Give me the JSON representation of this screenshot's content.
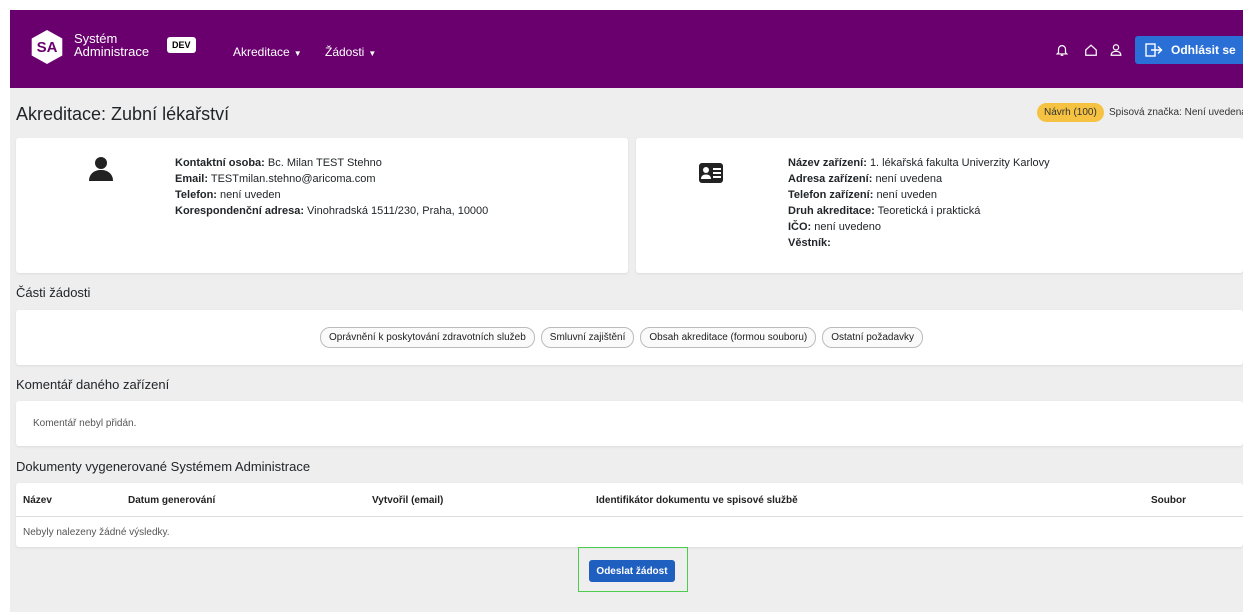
{
  "navbar": {
    "logo_initials": "SA",
    "app_name_line1": "Systém",
    "app_name_line2": "Administrace",
    "env_badge": "DEV",
    "menu": [
      {
        "label": "Akreditace"
      },
      {
        "label": "Žádosti"
      }
    ],
    "logout_label": "Odhlásit se",
    "icons": [
      "bell-icon",
      "home-icon",
      "user-icon",
      "logout-icon"
    ],
    "bg_color": "#6a006e",
    "logout_color": "#2a6fd6"
  },
  "page": {
    "title": "Akreditace: Zubní lékařství",
    "status_badge": "Návrh (100)",
    "file_ref": "Spisová značka: Není uvedena"
  },
  "contact_card": {
    "icon": "person-icon",
    "rows": [
      {
        "label": "Kontaktní osoba:",
        "value": "Bc. Milan TEST Stehno"
      },
      {
        "label": "Email:",
        "value": "TESTmilan.stehno@aricoma.com"
      },
      {
        "label": "Telefon:",
        "value": "není uveden"
      },
      {
        "label": "Korespondenční adresa:",
        "value": "Vinohradská 1511/230, Praha, 10000"
      }
    ]
  },
  "facility_card": {
    "icon": "id-card-icon",
    "rows": [
      {
        "label": "Název zařízení:",
        "value": "1. lékařská fakulta Univerzity Karlovy"
      },
      {
        "label": "Adresa zařízení:",
        "value": "není uvedena"
      },
      {
        "label": "Telefon zařízení:",
        "value": "není uveden"
      },
      {
        "label": "Druh akreditace:",
        "value": "Teoretická i praktická"
      },
      {
        "label": "IČO:",
        "value": "není uvedeno"
      },
      {
        "label": "Věstník:",
        "value": ""
      }
    ]
  },
  "parts": {
    "heading": "Části žádosti",
    "chips": [
      "Oprávnění k poskytování zdravotních služeb",
      "Smluvní zajištění",
      "Obsah akreditace (formou souboru)",
      "Ostatní požadavky"
    ]
  },
  "comment": {
    "heading": "Komentář daného zařízení",
    "text": "Komentář nebyl přidán."
  },
  "documents": {
    "heading": "Dokumenty vygenerované Systémem Administrace",
    "columns": [
      "Název",
      "Datum generování",
      "Vytvořil (email)",
      "Identifikátor dokumentu ve spisové službě",
      "Soubor"
    ],
    "empty_text": "Nebyly nalezeny žádné výsledky."
  },
  "submit": {
    "label": "Odeslat žádost",
    "highlight_color": "#4ccc4c"
  }
}
